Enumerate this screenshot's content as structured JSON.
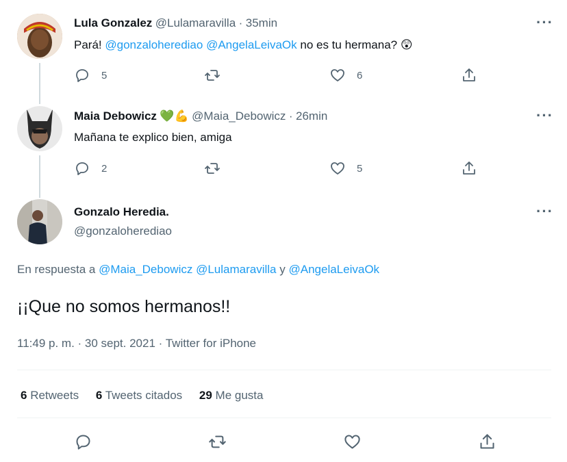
{
  "tweets": [
    {
      "name": "Lula Gonzalez",
      "handle": "@Lulamaravilla",
      "time": "35min",
      "text_before": "Pará! ",
      "mention1": "@gonzaloherediao",
      "space": " ",
      "mention2": "@AngelaLeivaOk",
      "text_after": " no es tu hermana?",
      "emoji": "😲",
      "replies": "5",
      "likes": "6"
    },
    {
      "name": "Maia Debowicz",
      "emoji_heart": "💚",
      "emoji_muscle": "💪",
      "handle": "@Maia_Debowicz",
      "time": "26min",
      "text": "Mañana te explico bien, amiga",
      "replies": "2",
      "likes": "5"
    }
  ],
  "main": {
    "name": "Gonzalo Heredia.",
    "handle": "@gonzaloherediao",
    "reply_prefix": "En respuesta a",
    "reply_to_1": "@Maia_Debowicz",
    "reply_to_2": "@Lulamaravilla",
    "reply_and": "y",
    "reply_to_3": "@AngelaLeivaOk",
    "text": "¡¡Que no somos hermanos!!",
    "timestamp": "11:49 p. m. · 30 sept. 2021 · Twitter for iPhone",
    "stats": {
      "retweets_count": "6",
      "retweets_label": "Retweets",
      "quotes_count": "6",
      "quotes_label": "Tweets citados",
      "likes_count": "29",
      "likes_label": "Me gusta"
    }
  },
  "separator": "·",
  "more_label": "···",
  "colors": {
    "accent": "#1d9bf0",
    "text": "#0f1419",
    "muted": "#536471",
    "heart_green": "#5cb85c"
  }
}
